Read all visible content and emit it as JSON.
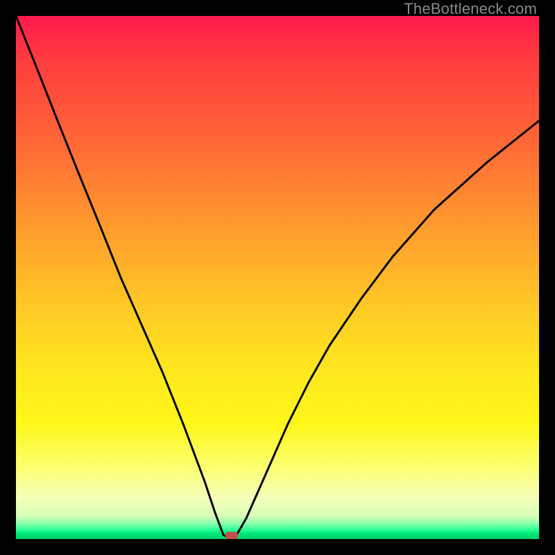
{
  "watermark": "TheBottleneck.com",
  "colors": {
    "frame": "#000000",
    "curve": "#000000",
    "marker": "#c0504d",
    "gradient_stops": [
      "#ff1a4d",
      "#ff6a35",
      "#ffc726",
      "#fff71a",
      "#f6ffb8",
      "#00d268"
    ]
  },
  "chart_data": {
    "type": "line",
    "title": "",
    "xlabel": "",
    "ylabel": "",
    "xlim": [
      0,
      100
    ],
    "ylim": [
      0,
      100
    ],
    "grid": false,
    "legend": false,
    "background": "heatmap-gradient red→green (vertical)",
    "series": [
      {
        "name": "bottleneck-curve",
        "x": [
          0,
          4,
          8,
          12,
          16,
          20,
          24,
          28,
          32,
          36,
          38,
          40,
          41,
          42,
          44,
          48,
          52,
          56,
          60,
          66,
          72,
          80,
          90,
          100
        ],
        "y": [
          100,
          90,
          80,
          70,
          60,
          50,
          41,
          32,
          22,
          11,
          5,
          0.5,
          0.3,
          0.5,
          4,
          13,
          22,
          30,
          37,
          46,
          54,
          63,
          72,
          80
        ]
      }
    ],
    "annotations": [
      {
        "name": "optimal-point-marker",
        "x": 41,
        "y": 0.3,
        "shape": "rounded-rect",
        "color": "#c0504d"
      }
    ]
  }
}
